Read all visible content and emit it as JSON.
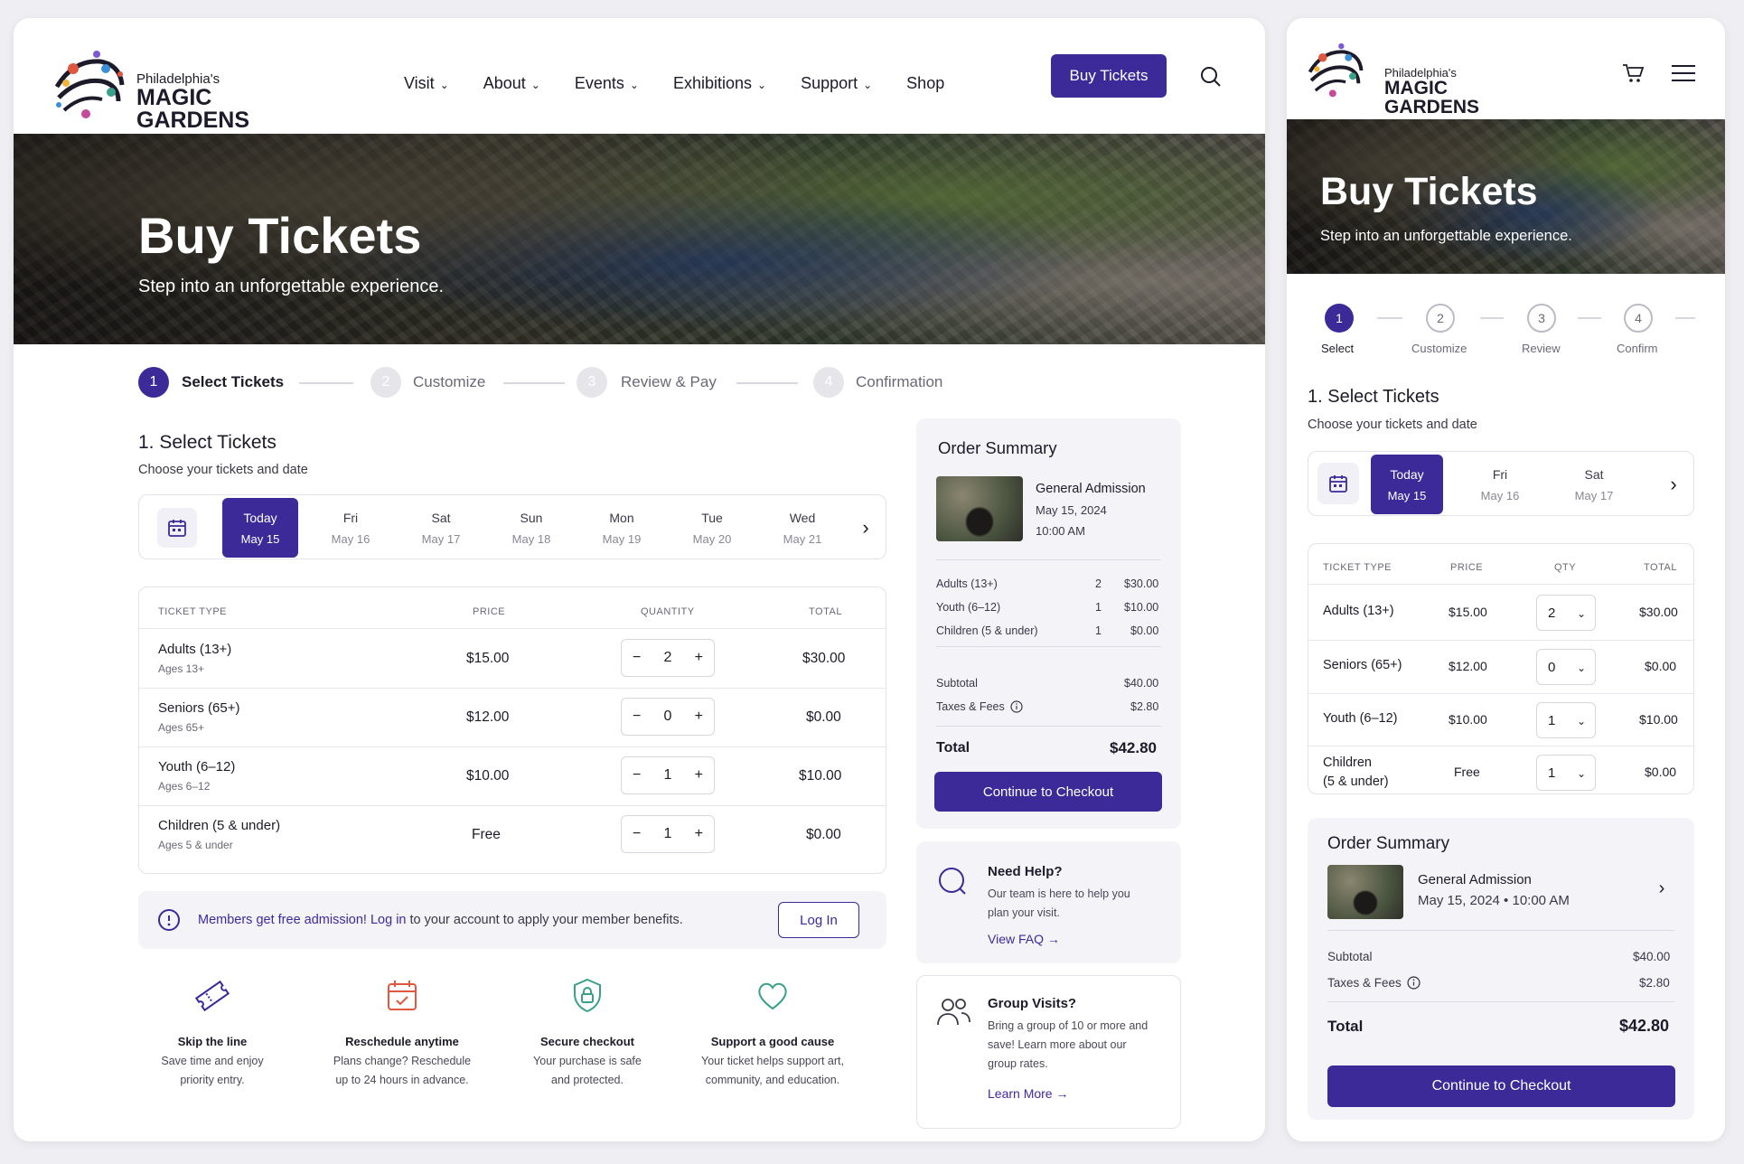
{
  "brand": {
    "line1": "Philadelphia's",
    "line2": "MAGIC",
    "line3": "GARDENS"
  },
  "nav": {
    "items": [
      {
        "label": "Visit",
        "dropdown": true
      },
      {
        "label": "About",
        "dropdown": true
      },
      {
        "label": "Events",
        "dropdown": true
      },
      {
        "label": "Exhibitions",
        "dropdown": true
      },
      {
        "label": "Support",
        "dropdown": true
      },
      {
        "label": "Shop",
        "dropdown": false
      }
    ],
    "cta": "Buy Tickets"
  },
  "hero": {
    "title": "Buy Tickets",
    "subtitle": "Step into an unforgettable experience."
  },
  "steps": {
    "desktop": [
      "Select Tickets",
      "Customize",
      "Review & Pay",
      "Confirmation"
    ],
    "mobile": [
      "Select",
      "Customize",
      "Review",
      "Confirm"
    ],
    "numbers": [
      "1",
      "2",
      "3",
      "4"
    ],
    "current": 1
  },
  "select": {
    "heading": "1. Select Tickets",
    "subheading": "Choose your tickets and date"
  },
  "dates": [
    {
      "day": "Today",
      "date": "May 15",
      "selected": true
    },
    {
      "day": "Fri",
      "date": "May 16"
    },
    {
      "day": "Sat",
      "date": "May 17"
    },
    {
      "day": "Sun",
      "date": "May 18"
    },
    {
      "day": "Mon",
      "date": "May 19"
    },
    {
      "day": "Tue",
      "date": "May 20"
    },
    {
      "day": "Wed",
      "date": "May 21"
    }
  ],
  "table": {
    "headers": {
      "type": "Ticket Type",
      "price": "Price",
      "quantity": "Quantity",
      "qty": "QTY",
      "total": "Total"
    },
    "rows": [
      {
        "name": "Adults (13+)",
        "sub": "Ages 13+",
        "price": "$15.00",
        "qty": "2",
        "total": "$30.00"
      },
      {
        "name": "Seniors (65+)",
        "sub": "Ages 65+",
        "price": "$12.00",
        "qty": "0",
        "total": "$0.00"
      },
      {
        "name": "Youth (6–12)",
        "sub": "Ages 6–12",
        "price": "$10.00",
        "qty": "1",
        "total": "$10.00"
      },
      {
        "name": "Children (5 & under)",
        "sub": "Ages 5 & under",
        "price": "Free",
        "qty": "1",
        "total": "$0.00"
      }
    ],
    "mobile_children_l1": "Children",
    "mobile_children_l2": "(5 & under)"
  },
  "members": {
    "link": "Members get free admission! Log in",
    "rest": " to your account to apply your member benefits.",
    "button": "Log In"
  },
  "features": [
    {
      "icon": "ticket-icon",
      "title": "Skip the line",
      "l1": "Save time and enjoy",
      "l2": "priority entry.",
      "color": "#3b2a98"
    },
    {
      "icon": "calendar-check-icon",
      "title": "Reschedule anytime",
      "l1": "Plans change? Reschedule",
      "l2": "up to 24 hours in advance.",
      "color": "#e0573f"
    },
    {
      "icon": "shield-lock-icon",
      "title": "Secure checkout",
      "l1": "Your purchase is safe",
      "l2": "and protected.",
      "color": "#3aa08a"
    },
    {
      "icon": "heart-icon",
      "title": "Support a good cause",
      "l1": "Your ticket helps support art,",
      "l2": "community, and education.",
      "color": "#3aa08a"
    }
  ],
  "summary": {
    "title": "Order Summary",
    "item": "General Admission",
    "date": "May 15, 2024",
    "time": "10:00 AM",
    "mobile_datetime": "May 15, 2024 • 10:00 AM",
    "lines": [
      {
        "label": "Adults (13+)",
        "qty": "2",
        "amount": "$30.00"
      },
      {
        "label": "Youth (6–12)",
        "qty": "1",
        "amount": "$10.00"
      },
      {
        "label": "Children (5 & under)",
        "qty": "1",
        "amount": "$0.00"
      }
    ],
    "subtotal_label": "Subtotal",
    "subtotal": "$40.00",
    "taxes_label": "Taxes & Fees",
    "taxes": "$2.80",
    "total_label": "Total",
    "total": "$42.80",
    "cta": "Continue to Checkout"
  },
  "help": {
    "title": "Need Help?",
    "l1": "Our team is here to help you",
    "l2": "plan your visit.",
    "link": "View FAQ"
  },
  "group": {
    "title": "Group Visits?",
    "l1": "Bring a group of 10 or more and",
    "l2": "save! Learn more about our",
    "l3": "group rates.",
    "link": "Learn More"
  },
  "colors": {
    "accent": "#3b2a98",
    "background": "#efeef2"
  }
}
